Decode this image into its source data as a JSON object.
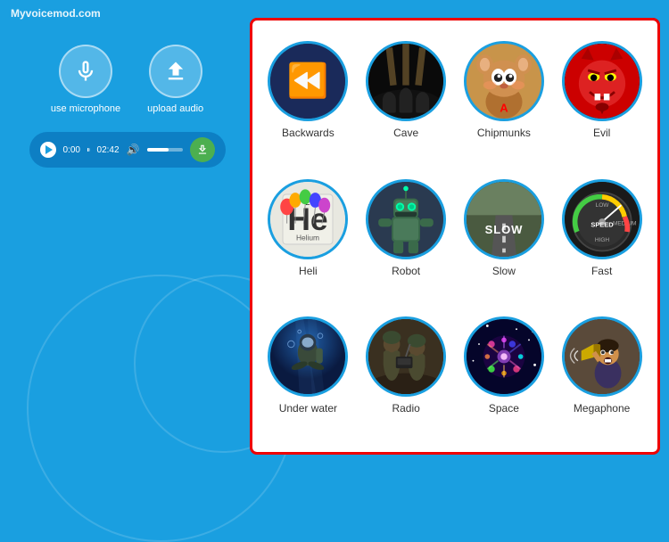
{
  "header": {
    "site": "Myvoicemod.com"
  },
  "leftPanel": {
    "micLabel": "use microphone",
    "uploadLabel": "upload audio",
    "player": {
      "currentTime": "0:00",
      "totalTime": "02:42"
    }
  },
  "voices": [
    {
      "id": "backwards",
      "label": "Backwards",
      "colorBg": "#1a2a4a"
    },
    {
      "id": "cave",
      "label": "Cave",
      "colorBg": "#111111"
    },
    {
      "id": "chipmunks",
      "label": "Chipmunks",
      "colorBg": "#c8a060"
    },
    {
      "id": "evil",
      "label": "Evil",
      "colorBg": "#1a0000"
    },
    {
      "id": "heli",
      "label": "Heli",
      "colorBg": "#e8e8e0"
    },
    {
      "id": "robot",
      "label": "Robot",
      "colorBg": "#2a3a4a"
    },
    {
      "id": "slow",
      "label": "Slow",
      "colorBg": "#3a4a3a"
    },
    {
      "id": "fast",
      "label": "Fast",
      "colorBg": "#1a1a1a"
    },
    {
      "id": "underwater",
      "label": "Under water",
      "colorBg": "#2a3a5a"
    },
    {
      "id": "radio",
      "label": "Radio",
      "colorBg": "#3a3020"
    },
    {
      "id": "space",
      "label": "Space",
      "colorBg": "#0a0a2a"
    },
    {
      "id": "megaphone",
      "label": "Megaphone",
      "colorBg": "#4a3a2a"
    }
  ]
}
